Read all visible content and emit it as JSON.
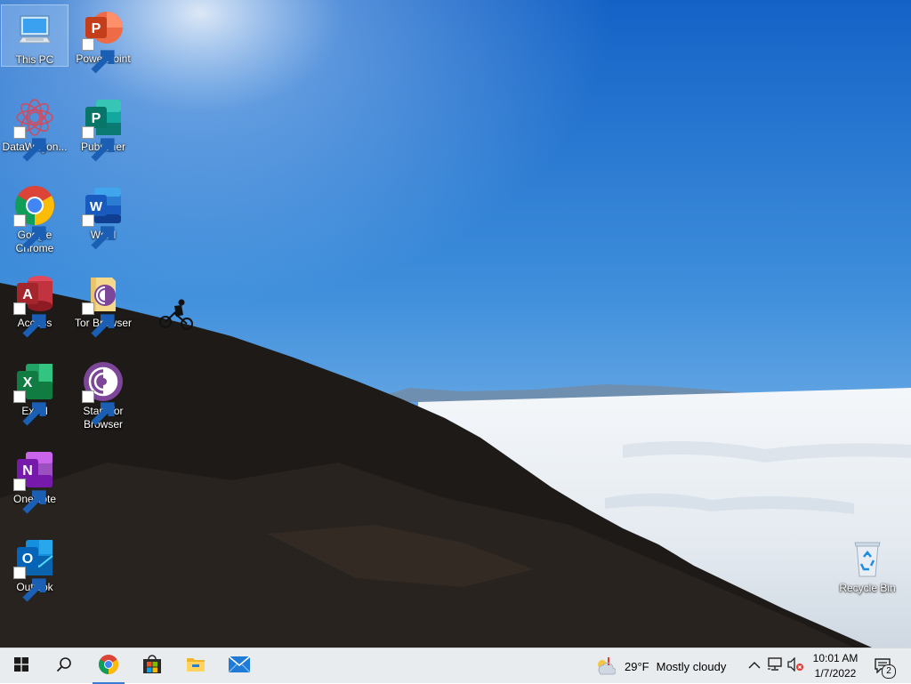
{
  "desktop": {
    "icons": [
      {
        "label": "This PC",
        "icon": "computer-icon"
      },
      {
        "label": "PowerPoint",
        "icon": "powerpoint-icon"
      },
      {
        "label": "DataWagon...",
        "icon": "datawagon-icon"
      },
      {
        "label": "Publisher",
        "icon": "publisher-icon"
      },
      {
        "label": "Google Chrome",
        "icon": "chrome-icon"
      },
      {
        "label": "Word",
        "icon": "word-icon"
      },
      {
        "label": "Access",
        "icon": "access-icon"
      },
      {
        "label": "Tor Browser",
        "icon": "tor-folder-icon"
      },
      {
        "label": "Excel",
        "icon": "excel-icon"
      },
      {
        "label": "Start Tor Browser",
        "icon": "tor-icon"
      },
      {
        "label": "OneNote",
        "icon": "onenote-icon"
      },
      {
        "label": "Outlook",
        "icon": "outlook-icon"
      },
      {
        "label": "Recycle Bin",
        "icon": "recycle-bin-icon"
      }
    ]
  },
  "taskbar": {
    "pinned": [
      "start-icon",
      "search-icon",
      "chrome-icon",
      "store-icon",
      "file-explorer-icon",
      "mail-icon"
    ],
    "weather": {
      "temp": "29°F",
      "condition": "Mostly cloudy"
    },
    "clock": {
      "time": "10:01 AM",
      "date": "1/7/2022"
    },
    "notifications": {
      "count": "2"
    }
  },
  "colors": {
    "sky_top": "#1565c8",
    "sky_bottom": "#8fc0ea",
    "taskbar": "#e9ecef",
    "accent": "#3a7bd5"
  }
}
